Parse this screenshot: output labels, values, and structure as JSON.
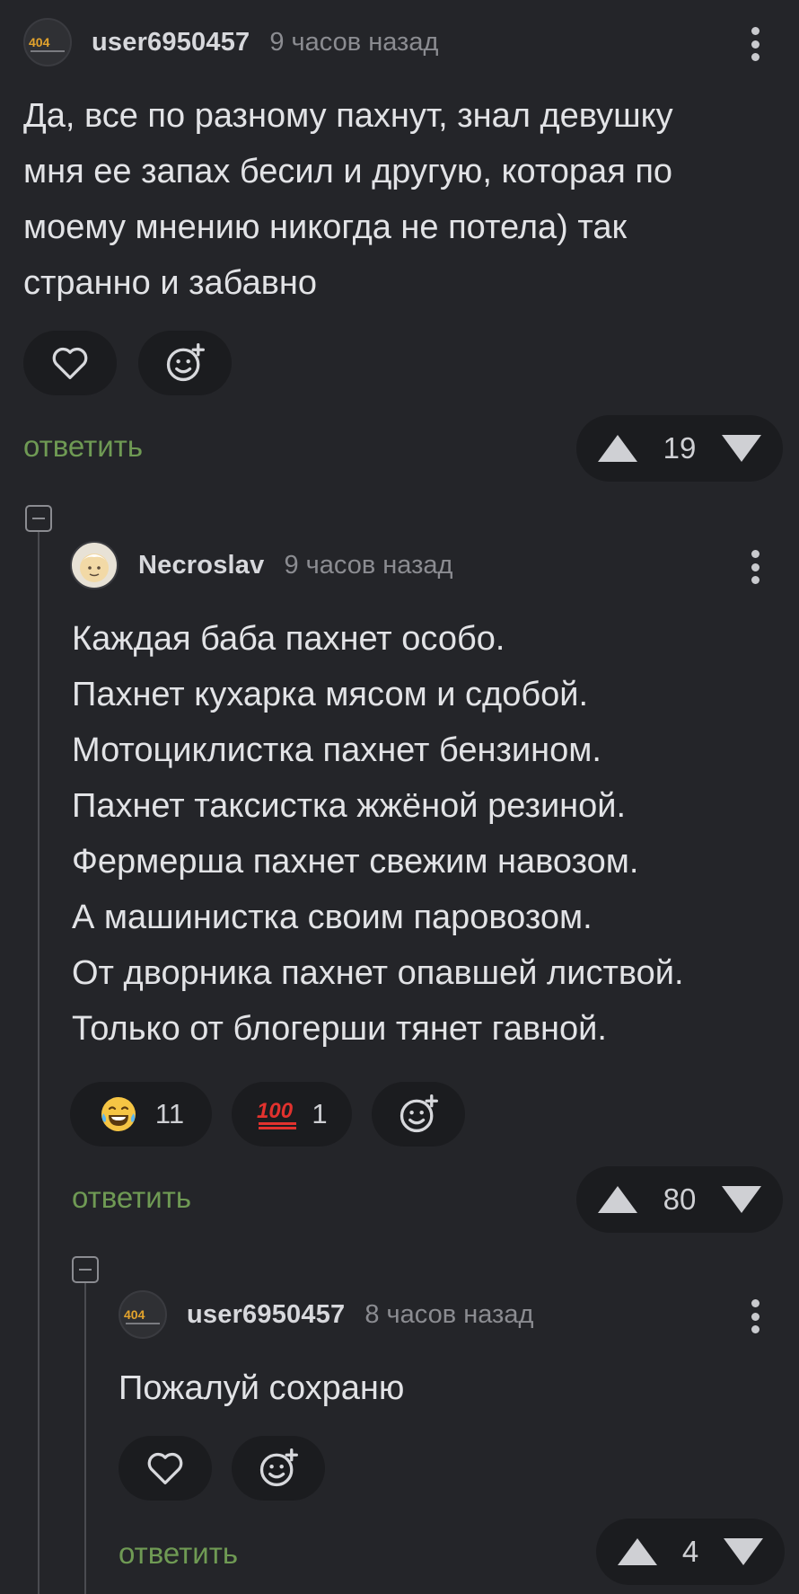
{
  "comments": [
    {
      "username": "user6950457",
      "time": "9 часов назад",
      "text": "Да, все по разному пахнут, знал девушку\nмня ее запах бесил и другую, которая по\nмоему мнению никогда не потела) так\nстранно и забавно",
      "reply_label": "ответить",
      "rating": "19"
    },
    {
      "username": "Necroslav",
      "time": "9 часов назад",
      "text": "Каждая баба пахнет особо.\nПахнет кухарка мясом и сдобой.\nМотоциклистка пахнет бензином.\nПахнет таксистка жжёной резиной.\nФермерша пахнет свежим навозом.\nА машинистка своим паровозом.\nОт дворника пахнет опавшей листвой.\nТолько от блогерши тянет гавной.",
      "reactions": [
        {
          "icon": "laugh-tears-icon",
          "count": "11"
        },
        {
          "icon": "hundred-icon",
          "count": "1"
        }
      ],
      "reply_label": "ответить",
      "rating": "80"
    },
    {
      "username": "user6950457",
      "time": "8 часов назад",
      "text": "Пожалуй сохраню",
      "reply_label": "ответить",
      "rating": "4"
    }
  ],
  "colors": {
    "background": "#242529",
    "pill": "#1b1c1f",
    "reply": "#6f9a54",
    "muted": "#8b8c91"
  }
}
